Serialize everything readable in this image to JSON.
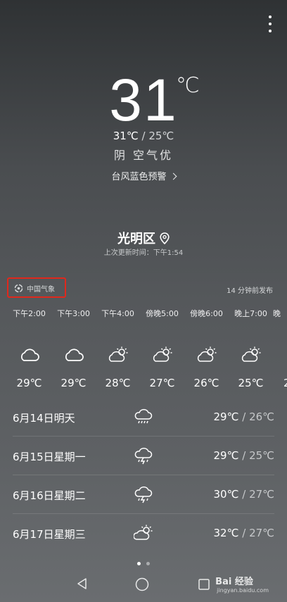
{
  "current": {
    "temp": "31",
    "unit": "℃",
    "high": "31℃",
    "sep": "/",
    "low": "25℃",
    "condition": "阴  空气优",
    "alert": "台风蓝色预警"
  },
  "location": {
    "city": "光明区",
    "updated": "上次更新时间：下午1:54"
  },
  "provider": {
    "name": "中国气象",
    "published": "14 分钟前发布"
  },
  "hourly": [
    {
      "time": "下午2:00",
      "icon": "cloudy-icon",
      "temp": "29℃"
    },
    {
      "time": "下午3:00",
      "icon": "cloudy-icon",
      "temp": "29℃"
    },
    {
      "time": "下午4:00",
      "icon": "partly-sunny-icon",
      "temp": "28℃"
    },
    {
      "time": "傍晚5:00",
      "icon": "partly-sunny-icon",
      "temp": "27℃"
    },
    {
      "time": "傍晚6:00",
      "icon": "partly-sunny-icon",
      "temp": "26℃"
    },
    {
      "time": "晚上7:00",
      "icon": "partly-sunny-icon",
      "temp": "25℃"
    },
    {
      "time": "晚",
      "icon": "",
      "temp": "2"
    }
  ],
  "daily": [
    {
      "date": "6月14日明天",
      "icon": "rain-icon",
      "high": "29℃",
      "low": "26℃"
    },
    {
      "date": "6月15日星期一",
      "icon": "thunderstorm-icon",
      "high": "29℃",
      "low": "25℃"
    },
    {
      "date": "6月16日星期二",
      "icon": "thunderstorm-icon",
      "high": "30℃",
      "low": "27℃"
    },
    {
      "date": "6月17日星期三",
      "icon": "partly-sunny-icon",
      "high": "32℃",
      "low": "27℃"
    }
  ],
  "range_sep": "/",
  "watermark": {
    "brand": "Bai 经验",
    "url": "jingyan.baidu.com"
  }
}
